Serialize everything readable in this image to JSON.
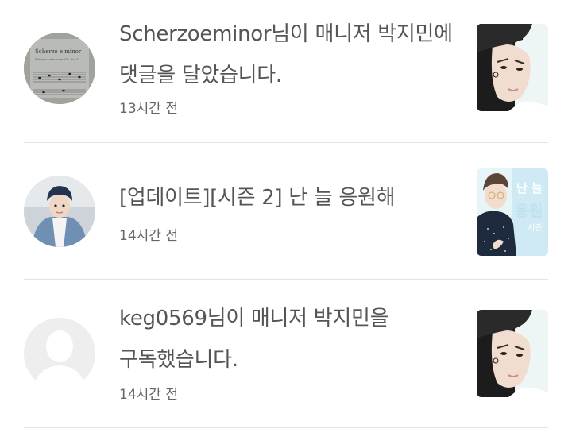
{
  "notifications": [
    {
      "message_line1": "Scherzoeminor님이 매니저 박지민에",
      "message_line2": "댓글을 달았습니다.",
      "time": "13시간 전",
      "avatar_text_1": "Scherzo e minor",
      "avatar_text_2": "Scherzo e minor Op.42 · No. 21"
    },
    {
      "message_line1": "[업데이트][시즌 2] 난 늘 응원해",
      "time": "14시간 전",
      "thumb_text_1": "난 늘",
      "thumb_text_2": "응원",
      "thumb_text_3": "시즌"
    },
    {
      "message_line1": "keg0569님이 매니저 박지민을",
      "message_line2": "구독했습니다.",
      "time": "14시간 전"
    }
  ],
  "colors": {
    "text": "#555555",
    "divider": "#e3e3e3",
    "placeholder_avatar": "#eeeeee"
  }
}
